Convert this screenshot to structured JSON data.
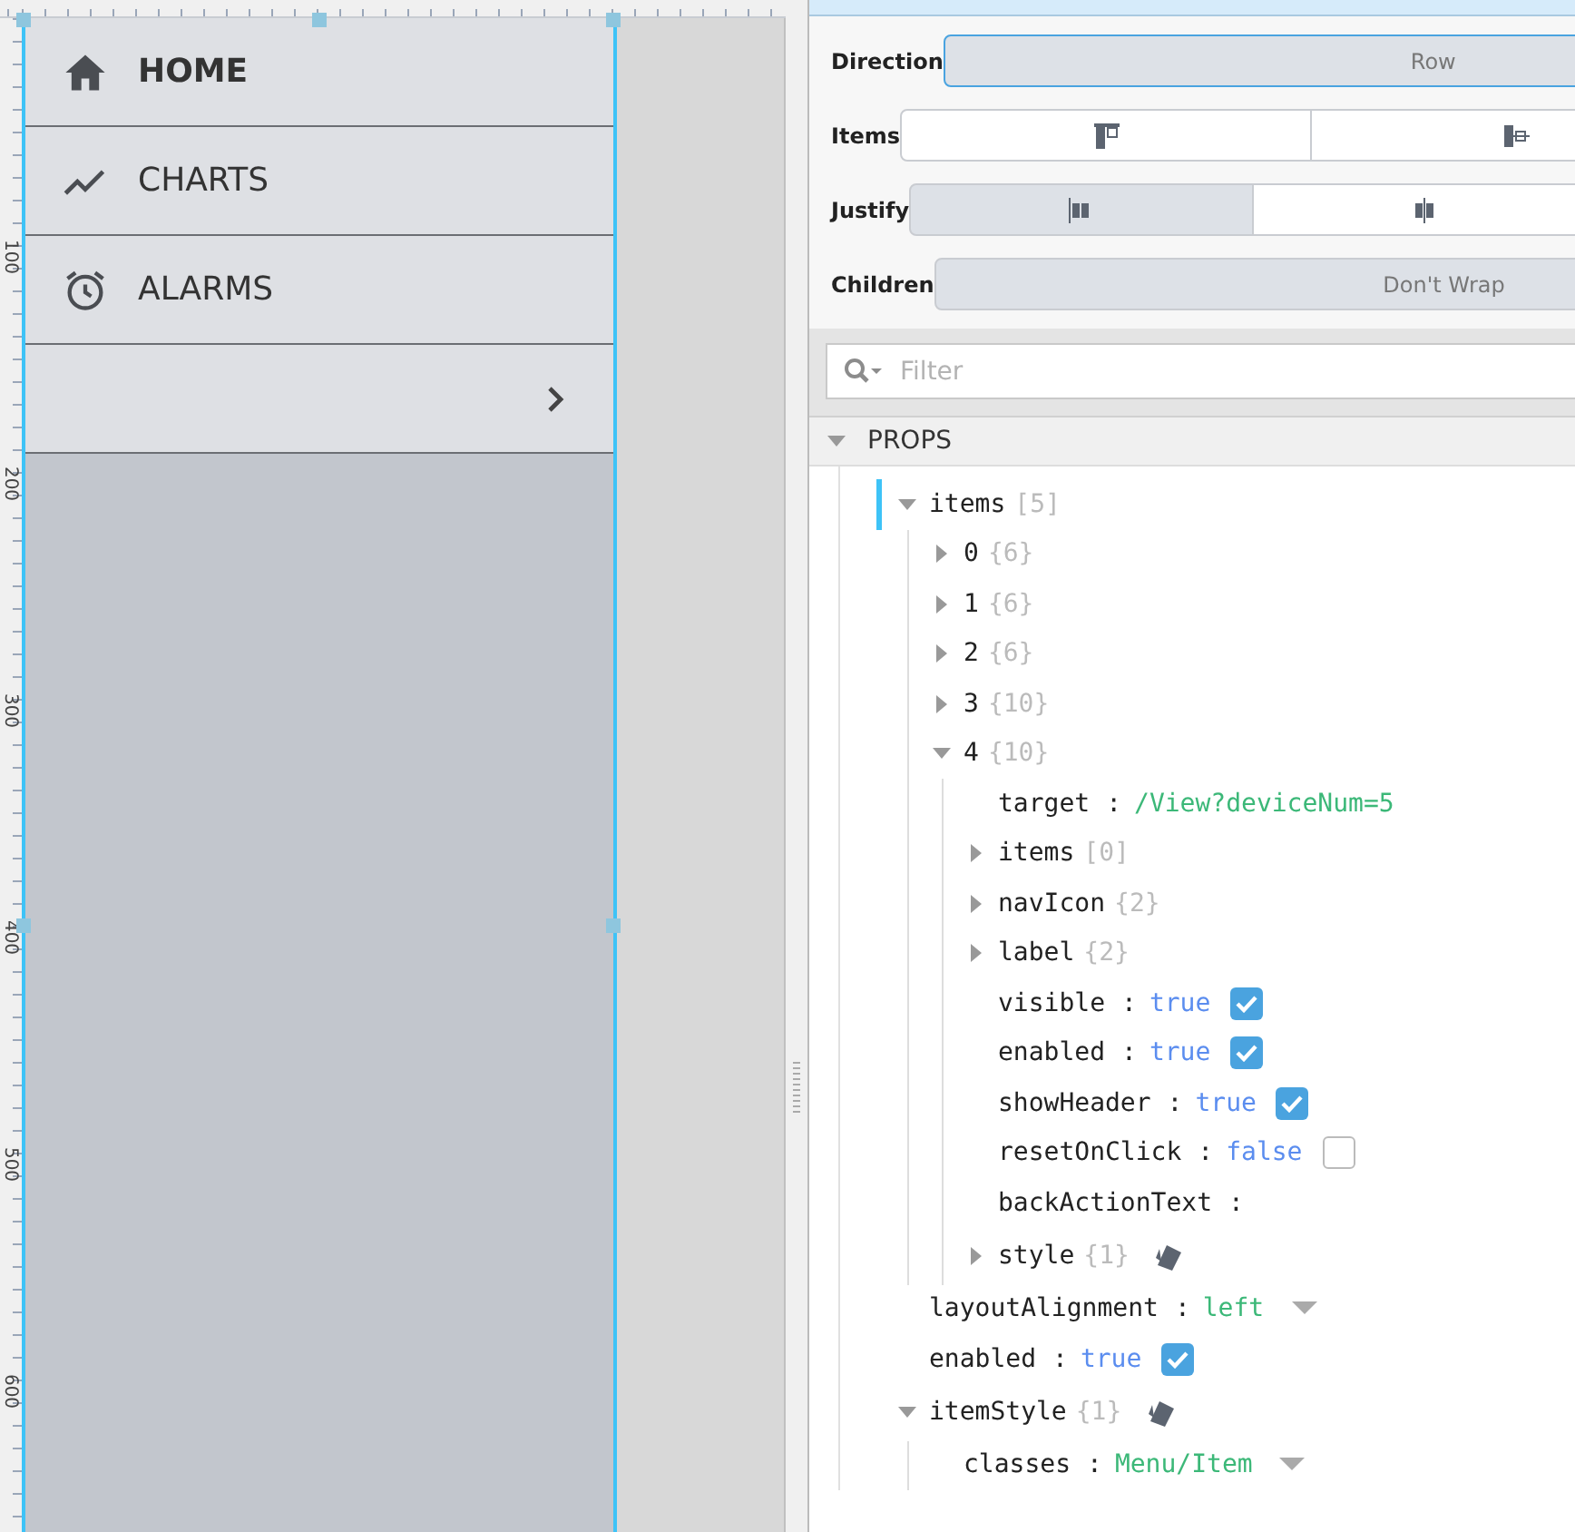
{
  "canvas": {
    "ruler_labels": [
      "100",
      "200",
      "300",
      "400",
      "500",
      "600"
    ]
  },
  "menu": {
    "items": [
      {
        "kind": "home",
        "label": "HOME",
        "selected": true
      },
      {
        "kind": "chart",
        "label": "CHARTS",
        "selected": false
      },
      {
        "kind": "alarm",
        "label": "ALARMS",
        "selected": false
      },
      {
        "kind": "submenu",
        "selected": false
      }
    ]
  },
  "layout_editor": {
    "rows": [
      {
        "label": "Direction",
        "focused": true,
        "options": [
          {
            "text": "Row",
            "selected": true
          }
        ]
      },
      {
        "label": "Items",
        "focused": false,
        "options": [
          {
            "kind": "align-top",
            "selected": false
          },
          {
            "kind": "align-center",
            "selected": false
          }
        ]
      },
      {
        "label": "Justify",
        "focused": false,
        "options": [
          {
            "kind": "justify-start",
            "selected": true
          },
          {
            "kind": "justify-center",
            "selected": false
          }
        ]
      },
      {
        "label": "Children",
        "focused": false,
        "options": [
          {
            "text": "Don't Wrap",
            "selected": true
          }
        ]
      }
    ]
  },
  "filter": {
    "placeholder": "Filter"
  },
  "props": {
    "label": "PROPS",
    "expanded": true,
    "children": [
      {
        "key": "items",
        "kind": "object",
        "meta": "[5]",
        "expanded": true,
        "selected": true,
        "children": [
          {
            "key": "0",
            "kind": "object",
            "meta": "{6}",
            "expanded": false
          },
          {
            "key": "1",
            "kind": "object",
            "meta": "{6}",
            "expanded": false
          },
          {
            "key": "2",
            "kind": "object",
            "meta": "{6}",
            "expanded": false
          },
          {
            "key": "3",
            "kind": "object",
            "meta": "{10}",
            "expanded": false
          },
          {
            "key": "4",
            "kind": "object",
            "meta": "{10}",
            "expanded": true,
            "children": [
              {
                "key": "target",
                "kind": "string",
                "sep": ":",
                "value": "/View?deviceNum=5"
              },
              {
                "key": "items",
                "kind": "object",
                "meta": "[0]",
                "expanded": false
              },
              {
                "key": "navIcon",
                "kind": "object",
                "meta": "{2}",
                "expanded": false
              },
              {
                "key": "label",
                "kind": "object",
                "meta": "{2}",
                "expanded": false
              },
              {
                "key": "visible",
                "kind": "bool",
                "sep": ":",
                "value": "true",
                "checked": true
              },
              {
                "key": "enabled",
                "kind": "bool",
                "sep": ":",
                "value": "true",
                "checked": true
              },
              {
                "key": "showHeader",
                "kind": "bool",
                "sep": ":",
                "value": "true",
                "checked": true
              },
              {
                "key": "resetOnClick",
                "kind": "bool",
                "sep": ":",
                "value": "false",
                "checked": false
              },
              {
                "key": "backActionText",
                "kind": "string",
                "sep": ":"
              },
              {
                "key": "style",
                "kind": "style",
                "meta": "{1}",
                "expanded": false
              }
            ]
          }
        ]
      },
      {
        "key": "layoutAlignment",
        "kind": "enum",
        "sep": ":",
        "value": "left"
      },
      {
        "key": "enabled",
        "kind": "bool",
        "sep": ":",
        "value": "true",
        "checked": true
      },
      {
        "key": "itemStyle",
        "kind": "style",
        "meta": "{1}",
        "expanded": true,
        "children": [
          {
            "key": "classes",
            "kind": "enum",
            "sep": ":",
            "value": "Menu/Item"
          }
        ]
      }
    ]
  }
}
